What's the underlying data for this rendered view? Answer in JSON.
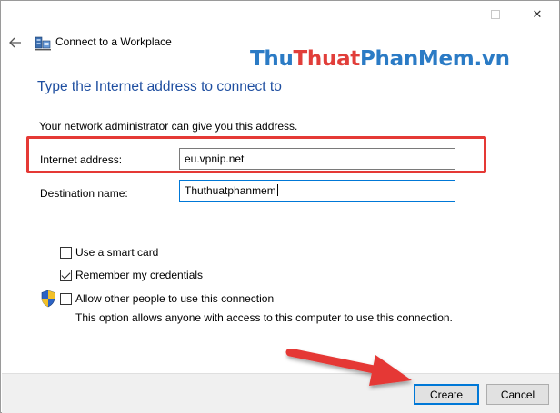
{
  "window": {
    "title": "Connect to a Workplace",
    "controls": {
      "minimize": "minimize",
      "maximize": "maximize",
      "close": "✕"
    }
  },
  "watermark": {
    "part1": "Thu",
    "part2": "Thuat",
    "part3": "PhanMem",
    "part4": ".vn"
  },
  "heading": "Type the Internet address to connect to",
  "instruction": "Your network administrator can give you this address.",
  "form": {
    "address_label": "Internet address:",
    "address_value": "eu.vpnip.net",
    "destination_label": "Destination name:",
    "destination_value": "Thuthuatphanmem"
  },
  "options": {
    "smart_card": {
      "label": "Use a smart card",
      "checked": false
    },
    "remember": {
      "label": "Remember my credentials",
      "checked": true
    },
    "allow_others": {
      "label": "Allow other people to use this connection",
      "checked": false
    },
    "allow_desc": "This option allows anyone with access to this computer to use this connection."
  },
  "buttons": {
    "create": "Create",
    "cancel": "Cancel"
  },
  "colors": {
    "heading": "#1e4ea0",
    "highlight": "#e53935",
    "accent": "#0078d7"
  }
}
